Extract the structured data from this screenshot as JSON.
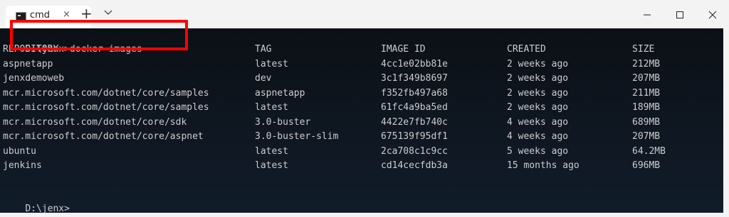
{
  "window": {
    "tab_label": "cmd",
    "tab_close": "×",
    "new_tab": "+",
    "icons": [
      "cmd-icon",
      "close-icon",
      "plus-icon",
      "chevron-down-icon",
      "minimize-icon",
      "maximize-icon",
      "close-window-icon"
    ]
  },
  "terminal": {
    "prompt_command": "D:\\jenx>docker images",
    "headers": [
      "REPOSITORY",
      "TAG",
      "IMAGE ID",
      "CREATED",
      "SIZE"
    ],
    "rows": [
      [
        "aspnetapp",
        "latest",
        "4cc1e02bb81e",
        "2 weeks ago",
        "212MB"
      ],
      [
        "jenxdemoweb",
        "dev",
        "3c1f349b8697",
        "2 weeks ago",
        "207MB"
      ],
      [
        "mcr.microsoft.com/dotnet/core/samples",
        "aspnetapp",
        "f352fb497a68",
        "2 weeks ago",
        "211MB"
      ],
      [
        "mcr.microsoft.com/dotnet/core/samples",
        "latest",
        "61fc4a9ba5ed",
        "2 weeks ago",
        "189MB"
      ],
      [
        "mcr.microsoft.com/dotnet/core/sdk",
        "3.0-buster",
        "4422e7fb740c",
        "4 weeks ago",
        "689MB"
      ],
      [
        "mcr.microsoft.com/dotnet/core/aspnet",
        "3.0-buster-slim",
        "675139f95df1",
        "4 weeks ago",
        "207MB"
      ],
      [
        "ubuntu",
        "latest",
        "2ca708c1c9cc",
        "5 weeks ago",
        "64.2MB"
      ],
      [
        "jenkins",
        "latest",
        "cd14cecfdb3a",
        "15 months ago",
        "696MB"
      ]
    ],
    "final_prompt": "D:\\jenx>"
  },
  "colors": {
    "terminal_text": "#cccccc",
    "highlight_box": "#ff0000",
    "titlebar": "#f3f3f3"
  }
}
